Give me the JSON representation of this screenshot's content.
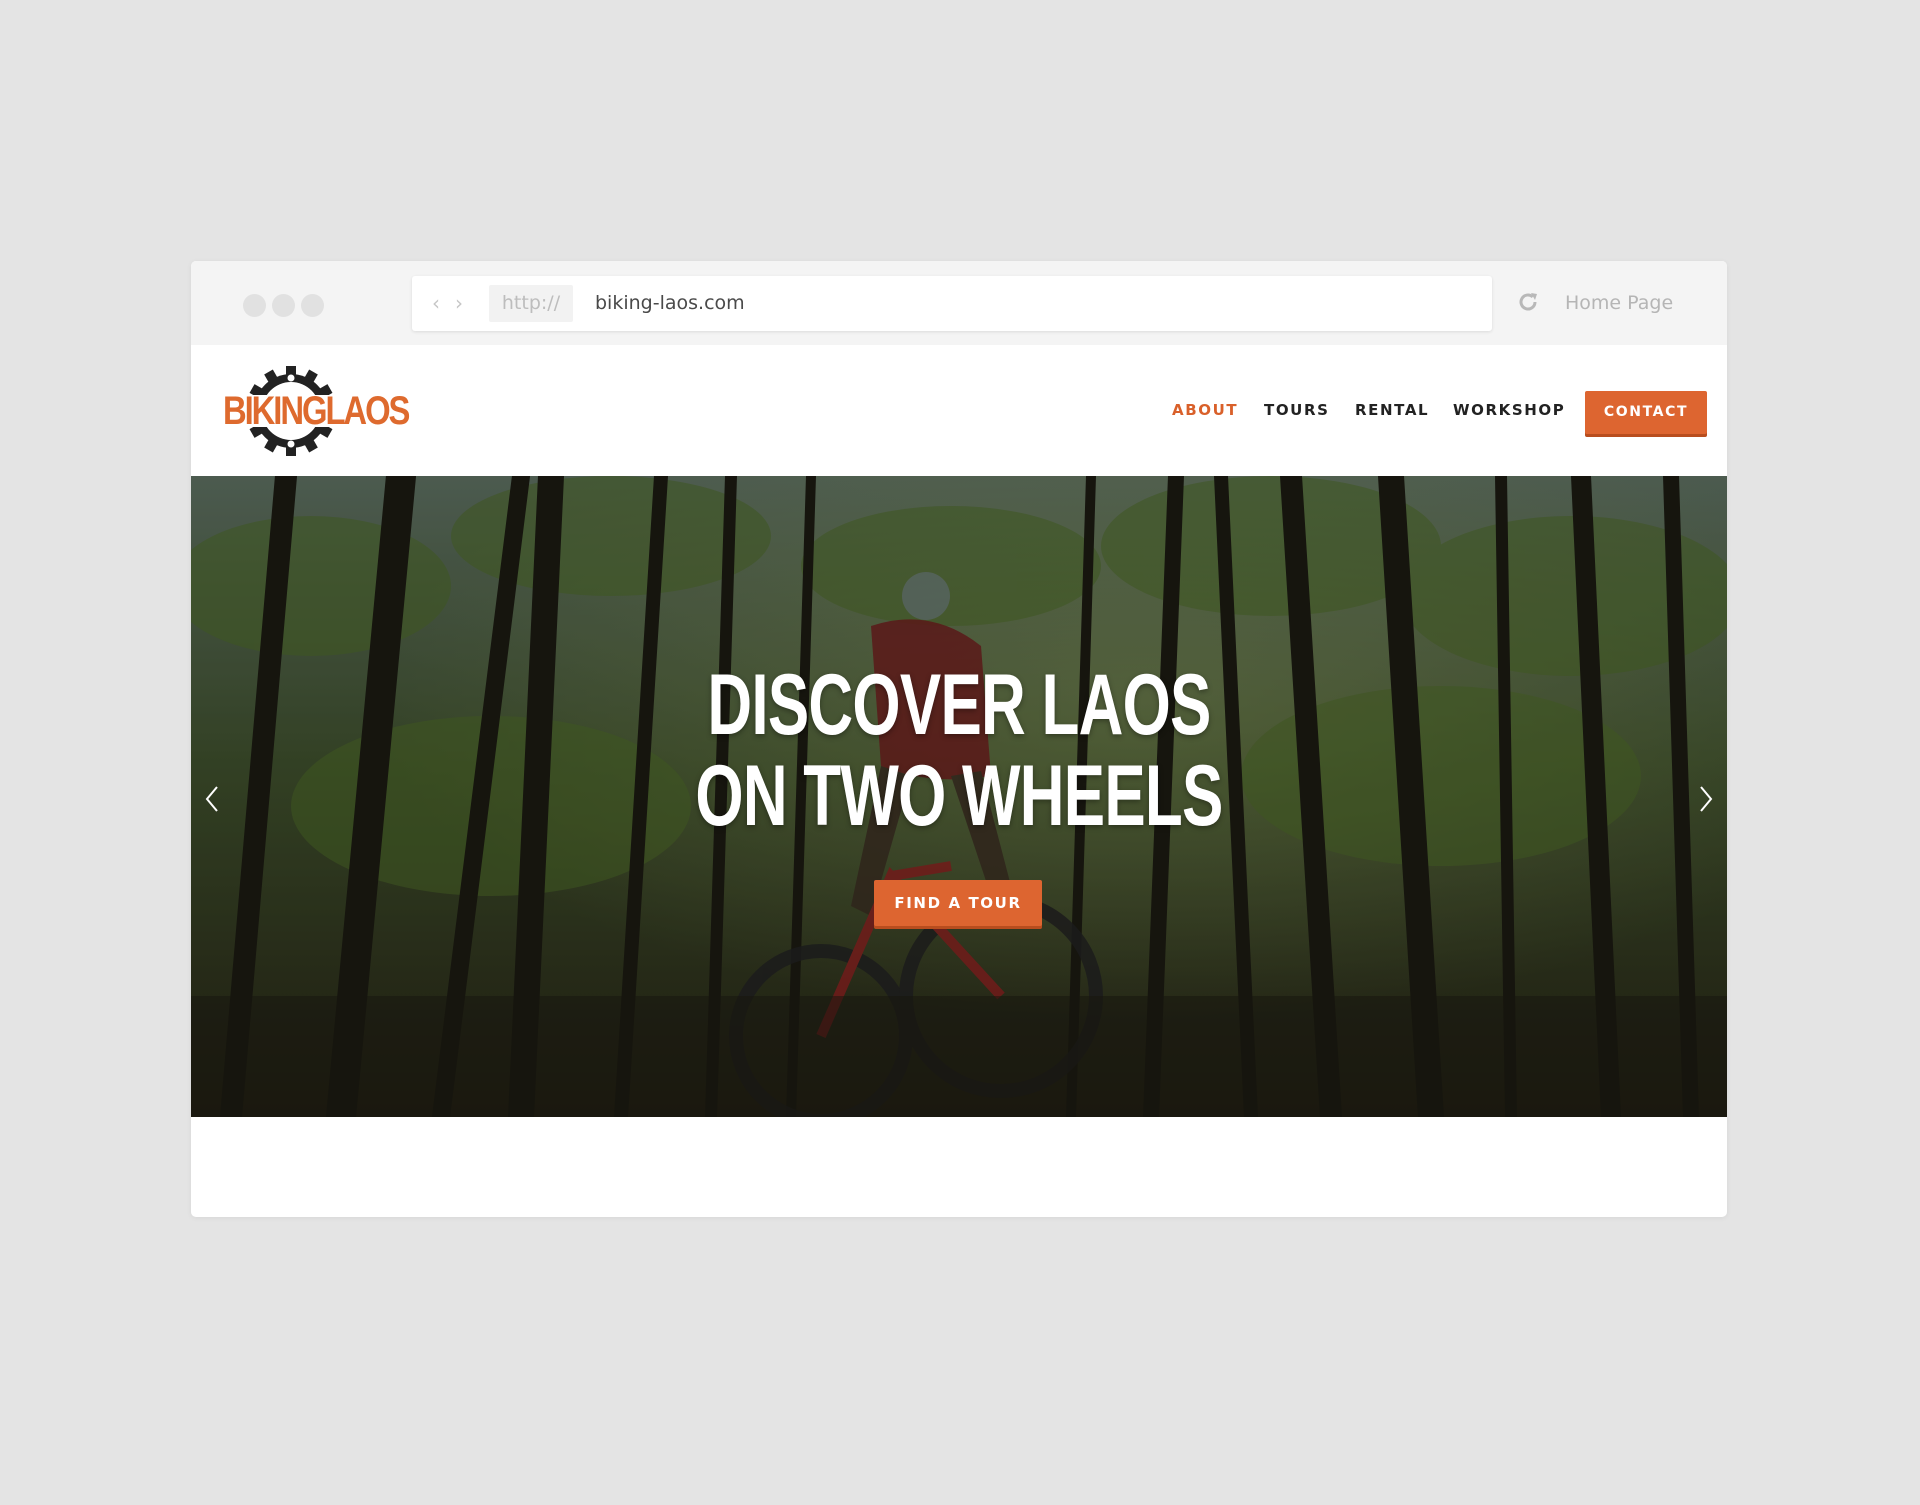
{
  "browser": {
    "protocol": "http://",
    "url": "biking-laos.com",
    "home_label": "Home Page"
  },
  "site": {
    "logo_text": "BIKINGLAOS",
    "nav": [
      {
        "label": "ABOUT",
        "active": true
      },
      {
        "label": "TOURS",
        "active": false
      },
      {
        "label": "RENTAL",
        "active": false
      },
      {
        "label": "WORKSHOP",
        "active": false
      }
    ],
    "contact_label": "CONTACT"
  },
  "hero": {
    "title_line1": "DISCOVER LAOS",
    "title_line2": "ON TWO WHEELS",
    "cta_label": "FIND A TOUR"
  },
  "colors": {
    "accent": "#dd6530",
    "page_bg": "#e4e4e4"
  }
}
